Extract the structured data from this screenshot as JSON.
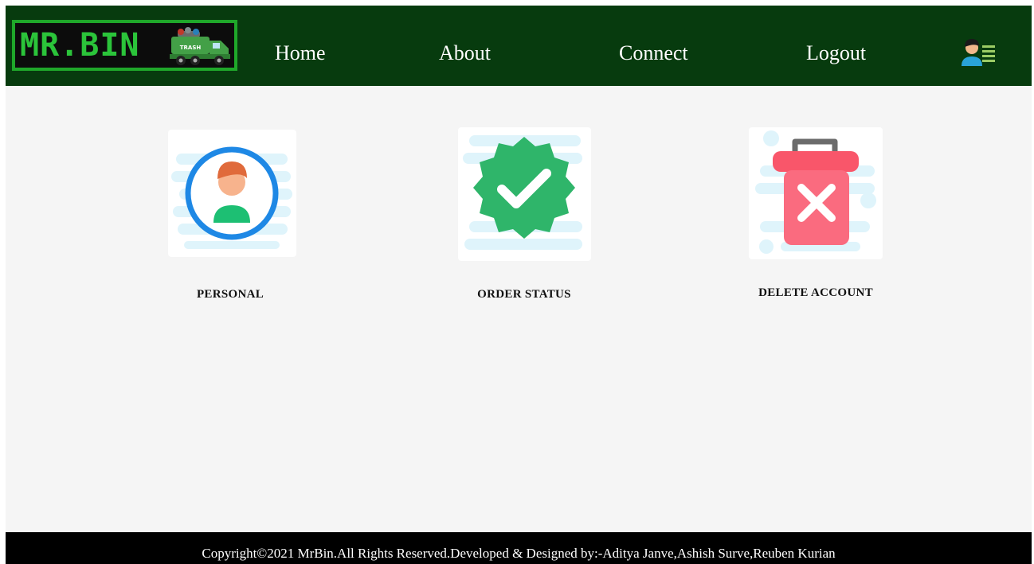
{
  "header": {
    "logo_text": "MR.BIN",
    "logo_truck_label": "TRASH",
    "nav": [
      {
        "label": "Home"
      },
      {
        "label": "About"
      },
      {
        "label": "Connect"
      },
      {
        "label": "Logout"
      }
    ],
    "avatar_menu_icon": "user-menu-icon"
  },
  "cards": [
    {
      "label": "PERSONAL",
      "icon": "user-profile-icon"
    },
    {
      "label": "ORDER STATUS",
      "icon": "checkmark-badge-icon"
    },
    {
      "label": "DELETE ACCOUNT",
      "icon": "trash-bin-x-icon"
    }
  ],
  "footer": {
    "text": "Copyright©2021 MrBin.All Rights Reserved.Developed & Designed by:-Aditya Janve,Ashish Surve,Reuben Kurian"
  },
  "colors": {
    "header_bg": "#073b0e",
    "logo_green": "#2bc43a",
    "main_bg": "#f5f5f5",
    "footer_bg": "#000000"
  }
}
